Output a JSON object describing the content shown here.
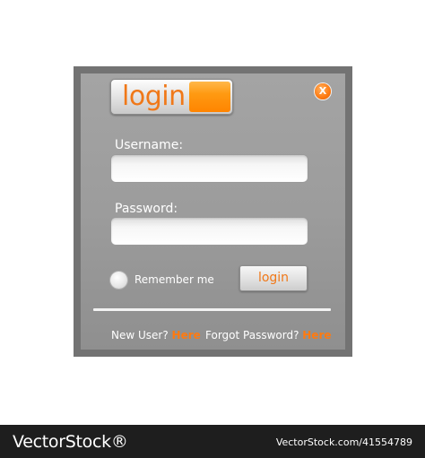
{
  "dialog": {
    "title": "login",
    "close_label": "X",
    "username_label": "Username:",
    "username_value": "",
    "password_label": "Password:",
    "password_value": "",
    "remember_label": "Remember me",
    "login_button_label": "login",
    "new_user_text": "New User?",
    "new_user_link": "Here",
    "forgot_password_text": "Forgot Password?",
    "forgot_password_link": "Here"
  },
  "colors": {
    "accent": "#ff8400",
    "panel_border": "#737373",
    "panel_bg": "#9c9c9c"
  },
  "watermark": {
    "brand": "VectorStock®",
    "url": "VectorStock.com/41554789"
  }
}
